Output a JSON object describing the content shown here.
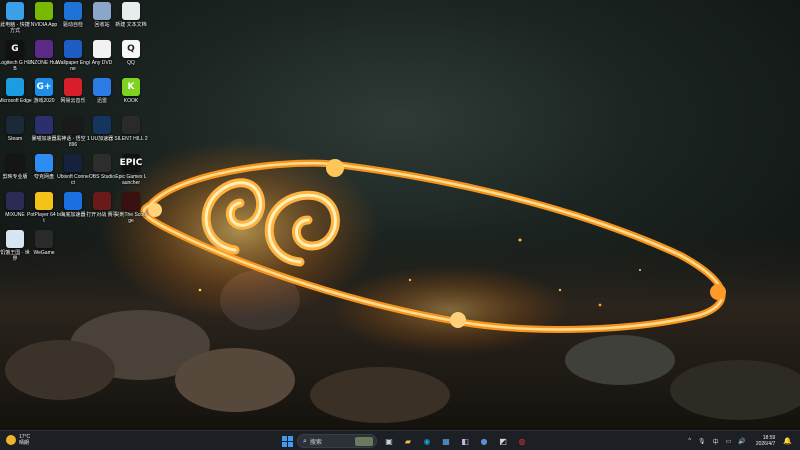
{
  "desktop_icons": [
    {
      "id": "this-pc",
      "label": "此电脑 - 快捷方式",
      "glyph": "",
      "color": "#3aa0e8"
    },
    {
      "id": "nvidia",
      "label": "NVIDIA App",
      "glyph": "",
      "color": "#76b900"
    },
    {
      "id": "driver",
      "label": "驱动自检",
      "glyph": "",
      "color": "#1e73d8"
    },
    {
      "id": "recycle",
      "label": "回收站",
      "glyph": "",
      "color": "#8aa6c8"
    },
    {
      "id": "newtxt",
      "label": "新建 文本文档",
      "glyph": "",
      "color": "#e9ecef"
    },
    {
      "id": "logitech",
      "label": "Logitech G HUB",
      "glyph": "G",
      "color": "#111111"
    },
    {
      "id": "inzone",
      "label": "INZONE Hub",
      "glyph": "",
      "color": "#5b2a86"
    },
    {
      "id": "wallpaper",
      "label": "Wallpaper Engine",
      "glyph": "",
      "color": "#1d5dc4"
    },
    {
      "id": "anydvd",
      "label": "Any DVD",
      "glyph": "",
      "color": "#f2f2f2"
    },
    {
      "id": "qq",
      "label": "QQ",
      "glyph": "Q",
      "color": "#f7f7f7"
    },
    {
      "id": "edge",
      "label": "Microsoft Edge",
      "glyph": "",
      "color": "#1b9de2"
    },
    {
      "id": "game2020",
      "label": "游戏2020",
      "glyph": "G+",
      "color": "#1e8ee8"
    },
    {
      "id": "netease",
      "label": "网易云音乐",
      "glyph": "",
      "color": "#d81e2a"
    },
    {
      "id": "xunlei",
      "label": "迅雷",
      "glyph": "",
      "color": "#2a7be4"
    },
    {
      "id": "kook",
      "label": "KOOK",
      "glyph": "K",
      "color": "#7ed321"
    },
    {
      "id": "steam",
      "label": "Steam",
      "glyph": "",
      "color": "#1b2838"
    },
    {
      "id": "ymaccel",
      "label": "暴喵加速器",
      "glyph": "",
      "color": "#2b2f6b"
    },
    {
      "id": "blackmyth",
      "label": "黑神话 · 悟空 1896",
      "glyph": "",
      "color": "#1a1a1a"
    },
    {
      "id": "uuaccel",
      "label": "UU加速器",
      "glyph": "",
      "color": "#14365e"
    },
    {
      "id": "silenthill",
      "label": "SILENT HILL 2",
      "glyph": "",
      "color": "#2a2a2a"
    },
    {
      "id": "capcut",
      "label": "剪映专业版",
      "glyph": "",
      "color": "#151515"
    },
    {
      "id": "quark",
      "label": "夸克网盘",
      "glyph": "",
      "color": "#2f8cf0"
    },
    {
      "id": "ubisoft",
      "label": "Ubisoft Connect",
      "glyph": "",
      "color": "#16213e"
    },
    {
      "id": "obs",
      "label": "OBS Studio",
      "glyph": "",
      "color": "#2d2d2d"
    },
    {
      "id": "epic",
      "label": "Epic Games Launcher",
      "glyph": "EPIC",
      "color": "#111111"
    },
    {
      "id": "mixune",
      "label": "MIXUNE",
      "glyph": "",
      "color": "#2b2b55"
    },
    {
      "id": "potplayer",
      "label": "PotPlayer 64 bit",
      "glyph": "",
      "color": "#f3c316"
    },
    {
      "id": "haidie",
      "label": "海底加速器",
      "glyph": "",
      "color": "#1b6fe0"
    },
    {
      "id": "jsgame",
      "label": "打开对战 赛事",
      "glyph": "",
      "color": "#6a1a1a"
    },
    {
      "id": "scourge",
      "label": "尖刺The Scourge",
      "glyph": "",
      "color": "#3a1010"
    },
    {
      "id": "yuanshen",
      "label": "饥饿王国 · 世界",
      "glyph": "",
      "color": "#d7e4f2"
    },
    {
      "id": "wegame",
      "label": "WeGame",
      "glyph": "",
      "color": "#2a2a2a"
    }
  ],
  "taskbar": {
    "weather": {
      "temp": "17°C",
      "desc": "晴朗"
    },
    "search_placeholder": "搜索",
    "tray": {
      "chevron": "^",
      "lang": "中",
      "clock_time": "18:59",
      "clock_date": "2026/4/7"
    },
    "pinned": [
      {
        "id": "task-view",
        "glyph": "▣",
        "color": "#c9d4e2"
      },
      {
        "id": "file-explorer",
        "glyph": "▰",
        "color": "#f0c24b"
      },
      {
        "id": "edge",
        "glyph": "◉",
        "color": "#1b9de2"
      },
      {
        "id": "store",
        "glyph": "▦",
        "color": "#5ab0f0"
      },
      {
        "id": "inzone",
        "glyph": "◧",
        "color": "#c5b6e6"
      },
      {
        "id": "steam",
        "glyph": "●",
        "color": "#5a8fd0"
      },
      {
        "id": "app-dark",
        "glyph": "◩",
        "color": "#d9d9d9"
      },
      {
        "id": "netease",
        "glyph": "◍",
        "color": "#e0303c"
      }
    ]
  }
}
